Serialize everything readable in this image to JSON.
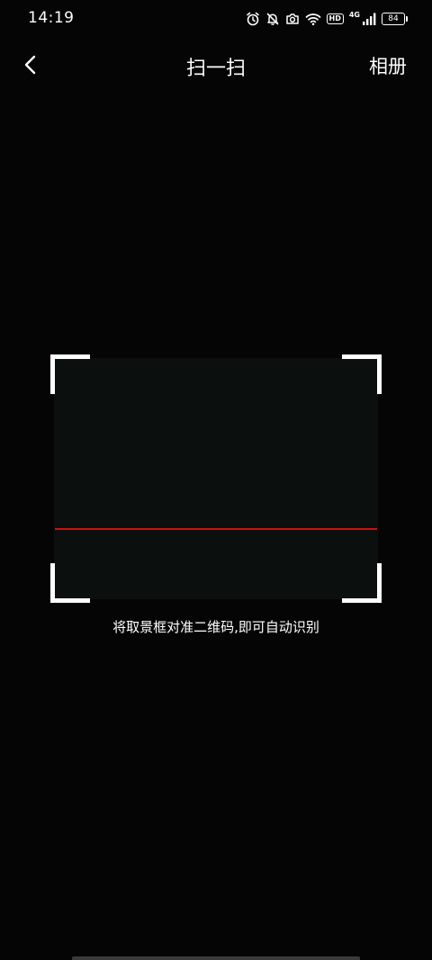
{
  "status_bar": {
    "time": "14:19",
    "network": "4G",
    "hd": "HD",
    "battery": "84",
    "icons": [
      "alarm-icon",
      "bell-off-icon",
      "camera-icon",
      "wifi-icon",
      "hd-icon",
      "signal-icon",
      "battery-icon"
    ]
  },
  "nav": {
    "title": "扫一扫",
    "album_label": "相册",
    "back_icon": "chevron-left-icon"
  },
  "scanner": {
    "hint": "将取景框对准二维码,即可自动识别",
    "scan_line_color": "#d01212",
    "frame_color": "#ffffff"
  }
}
